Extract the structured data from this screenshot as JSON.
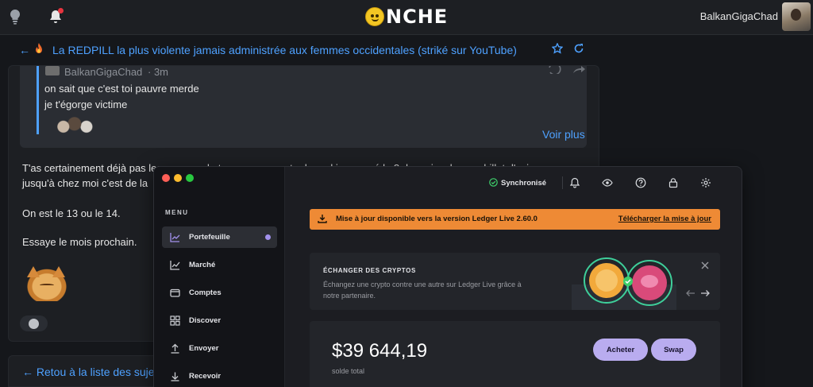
{
  "header": {
    "logo_text": "NCHE",
    "username": "BalkanGigaChad"
  },
  "topic": {
    "title": "La REDPILL la plus violente jamais administrée aux femmes occidentales (striké sur YouTube)"
  },
  "quote": {
    "author": "BalkanGigaChad",
    "time": "· 3m",
    "line1": "on sait que c'est toi pauvre merde",
    "line2": "je t'égorge victime",
    "voir_plus": "Voir plus"
  },
  "post": {
    "line1": "T'as certainement déjà pas les moyens de te payer une nuto de parking passé le 8 du mois, alors un billet d'avion",
    "line2": "jusqu'à chez moi c'est de la",
    "line3": "On est le 13 ou le 14.",
    "line4": "Essaye le mois prochain."
  },
  "back_list": "Retou à la liste des sujets",
  "ledger": {
    "menu_title": "MENU",
    "nav": [
      {
        "label": "Portefeuille",
        "icon": "chart-line-icon",
        "active": true
      },
      {
        "label": "Marché",
        "icon": "trend-icon"
      },
      {
        "label": "Comptes",
        "icon": "wallet-icon"
      },
      {
        "label": "Discover",
        "icon": "grid-icon"
      },
      {
        "label": "Envoyer",
        "icon": "arrow-up-icon"
      },
      {
        "label": "Recevoir",
        "icon": "arrow-down-icon"
      }
    ],
    "sync_label": "Synchronisé",
    "banner": {
      "text": "Mise à jour disponible vers la version Ledger Live 2.60.0",
      "link": "Télécharger la mise à jour"
    },
    "swap": {
      "title": "ÉCHANGER DES CRYPTOS",
      "desc_line1": "Échangez une crypto contre une autre sur Ledger Live grâce à",
      "desc_line2": "notre partenaire."
    },
    "balance": {
      "amount": "$39 644,19",
      "label": "solde total",
      "buy_label": "Acheter",
      "swap_label": "Swap"
    },
    "colors": {
      "accent": "#b9acef",
      "banner": "#ee8a35",
      "sync_ok": "#3ecf6b"
    }
  },
  "colors": {
    "link": "#4ea1ff",
    "background": "#15171b",
    "card": "#1d1f23"
  }
}
